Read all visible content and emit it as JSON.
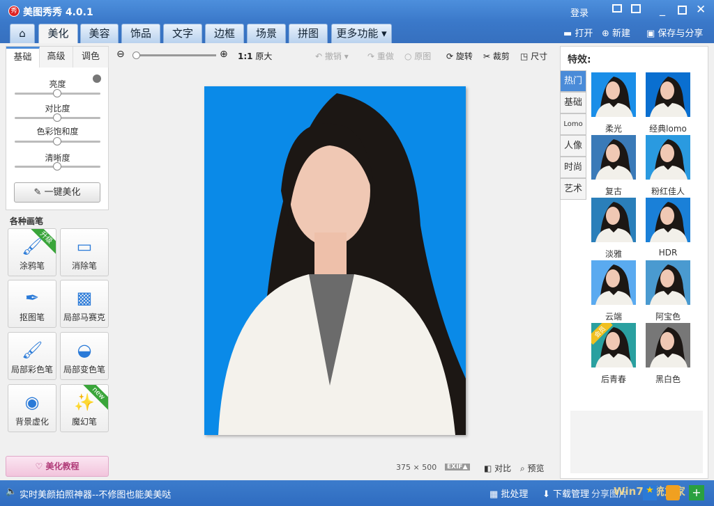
{
  "app": {
    "title": "美图秀秀 4.0.1",
    "login": "登录",
    "logo_text": "秀"
  },
  "tabs": [
    {
      "label": "美化",
      "active": true
    },
    {
      "label": "美容"
    },
    {
      "label": "饰品"
    },
    {
      "label": "文字"
    },
    {
      "label": "边框"
    },
    {
      "label": "场景"
    },
    {
      "label": "拼图"
    },
    {
      "label": "更多功能 ▾"
    }
  ],
  "topActions": {
    "open": "打开",
    "new": "新建",
    "save": "保存与分享"
  },
  "leftPanel": {
    "subtabs": [
      "基础",
      "高级",
      "调色"
    ],
    "sliders": [
      {
        "label": "亮度",
        "value": 50
      },
      {
        "label": "对比度",
        "value": 50
      },
      {
        "label": "色彩饱和度",
        "value": 50
      },
      {
        "label": "清晰度",
        "value": 50
      }
    ],
    "oneClick": "一键美化",
    "brushTitle": "各种画笔",
    "tools": [
      {
        "label": "涂鸦笔",
        "icon": "brush-icon",
        "badge": "升级"
      },
      {
        "label": "消除笔",
        "icon": "eraser-icon"
      },
      {
        "label": "抠图笔",
        "icon": "cutout-pen-icon"
      },
      {
        "label": "局部马赛克",
        "icon": "mosaic-icon"
      },
      {
        "label": "局部彩色笔",
        "icon": "color-brush-icon"
      },
      {
        "label": "局部变色笔",
        "icon": "recolor-icon"
      },
      {
        "label": "背景虚化",
        "icon": "blur-icon"
      },
      {
        "label": "魔幻笔",
        "icon": "magic-pen-icon",
        "badge": "new"
      }
    ],
    "tutorial": "美化教程"
  },
  "toolbar": {
    "ratio": "1:1",
    "actual": "原大",
    "undo": "撤销",
    "redo": "重做",
    "original": "原图",
    "rotate": "旋转",
    "crop": "裁剪",
    "size": "尺寸",
    "zoom": 10
  },
  "canvas": {
    "width": "375",
    "times": "×",
    "height": "500",
    "exif": "EXIF▲",
    "compare": "对比",
    "preview": "预览",
    "bg": "#0a8ae8"
  },
  "effects": {
    "title": "特效:",
    "categories": [
      "热门",
      "基础",
      "Lomo",
      "人像",
      "时尚",
      "艺术"
    ],
    "items": [
      {
        "label": "柔光",
        "tint": "#1a8ee8"
      },
      {
        "label": "经典lomo",
        "tint": "#0a6fd0"
      },
      {
        "label": "复古",
        "tint": "#3a7ab8"
      },
      {
        "label": "粉红佳人",
        "tint": "#2a9ae0"
      },
      {
        "label": "淡雅",
        "tint": "#2a7fba"
      },
      {
        "label": "HDR",
        "tint": "#1a80d8"
      },
      {
        "label": "云端",
        "tint": "#5aaaf0"
      },
      {
        "label": "阿宝色",
        "tint": "#4a9ad0"
      },
      {
        "label": "后青春",
        "tint": "#2aa0a0",
        "badge": "会员"
      },
      {
        "label": "黑白色",
        "tint": "#777777"
      }
    ]
  },
  "status": {
    "message": "实时美颜拍照神器--不修图也能美美哒",
    "batch": "批处理",
    "download": "下载管理",
    "share": "分享图片",
    "watermark": "Win7系统之家"
  }
}
